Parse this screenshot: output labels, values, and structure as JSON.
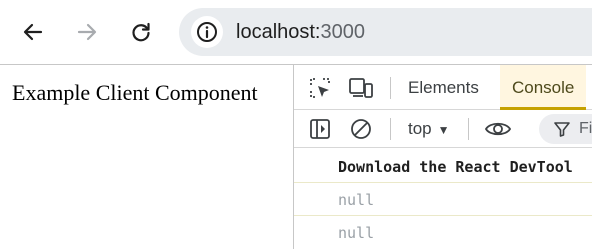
{
  "browser": {
    "back_icon": "arrow-left-icon",
    "forward_icon": "arrow-right-icon",
    "reload_icon": "reload-icon",
    "site_info_icon": "site-info-icon",
    "url_host": "localhost:",
    "url_port": "3000"
  },
  "page": {
    "text": "Example Client Component"
  },
  "devtools": {
    "tabs": [
      {
        "label": "Elements",
        "active": false
      },
      {
        "label": "Console",
        "active": true
      }
    ],
    "toolbar": {
      "context": "top",
      "filter_placeholder": "Fi"
    },
    "console_messages": [
      {
        "text": "Download the React DevTool",
        "kind": "info-bold"
      },
      {
        "text": "null",
        "kind": "log"
      },
      {
        "text": "null",
        "kind": "log"
      }
    ],
    "colors": {
      "active_tab_underline": "#c5a100",
      "active_tab_bg": "#fff6e0",
      "message_separator": "#ebe9c9"
    }
  }
}
